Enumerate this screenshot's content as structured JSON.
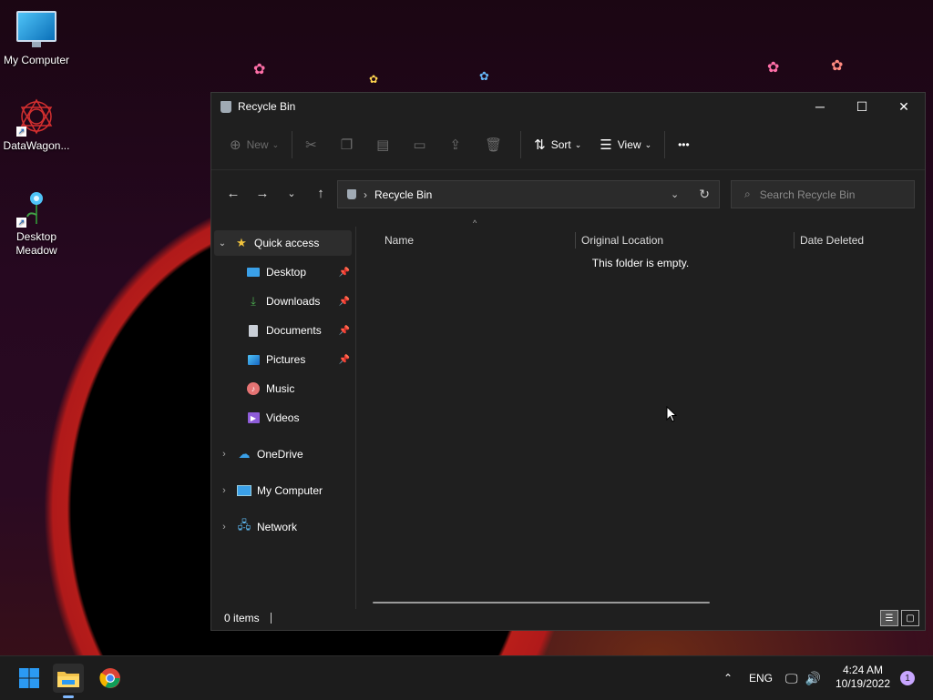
{
  "desktop": {
    "icons": [
      {
        "label": "My Computer"
      },
      {
        "label": "DataWagon..."
      },
      {
        "label": "Desktop Meadow"
      }
    ]
  },
  "window": {
    "title": "Recycle Bin",
    "controls": {
      "minimize": "─",
      "maximize": "☐",
      "close": "✕"
    },
    "toolbar": {
      "new_label": "New",
      "sort_label": "Sort",
      "view_label": "View",
      "more_label": "•••"
    },
    "address": {
      "location": "Recycle Bin",
      "separator": "›",
      "search_placeholder": "Search Recycle Bin"
    },
    "sidebar": {
      "quick_access": "Quick access",
      "pinned": [
        {
          "label": "Desktop",
          "icon": "desktop-icon"
        },
        {
          "label": "Downloads",
          "icon": "download-icon"
        },
        {
          "label": "Documents",
          "icon": "document-icon"
        },
        {
          "label": "Pictures",
          "icon": "pictures-icon"
        }
      ],
      "unpinned": [
        {
          "label": "Music",
          "icon": "music-icon"
        },
        {
          "label": "Videos",
          "icon": "videos-icon"
        }
      ],
      "roots": [
        {
          "label": "OneDrive",
          "icon": "cloud-icon"
        },
        {
          "label": "My Computer",
          "icon": "computer-icon"
        },
        {
          "label": "Network",
          "icon": "network-icon"
        }
      ]
    },
    "columns": [
      {
        "label": "Name"
      },
      {
        "label": "Original Location"
      },
      {
        "label": "Date Deleted"
      }
    ],
    "empty_message": "This folder is empty.",
    "status": {
      "item_count": "0 items"
    }
  },
  "taskbar": {
    "tray": {
      "language": "ENG",
      "time": "4:24 AM",
      "date": "10/19/2022",
      "notification_count": "1"
    }
  },
  "colors": {
    "accent": "#0078d4",
    "window_bg": "#1f1f1f",
    "star": "#f2c43d",
    "folder": "#f3c34b"
  }
}
